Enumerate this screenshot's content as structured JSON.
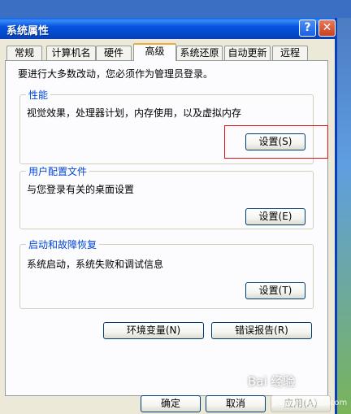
{
  "window": {
    "title": "系统属性"
  },
  "tabs": [
    {
      "label": "常规",
      "active": false
    },
    {
      "label": "计算机名",
      "active": false
    },
    {
      "label": "硬件",
      "active": false
    },
    {
      "label": "高级",
      "active": true
    },
    {
      "label": "系统还原",
      "active": false
    },
    {
      "label": "自动更新",
      "active": false
    },
    {
      "label": "远程",
      "active": false
    }
  ],
  "admin_note": "要进行大多数改动，您必须作为管理员登录。",
  "performance": {
    "title": "性能",
    "description": "视觉效果，处理器计划，内存使用，以及虚拟内存",
    "button": "设置(S)"
  },
  "user_profiles": {
    "title": "用户配置文件",
    "description": "与您登录有关的桌面设置",
    "button": "设置(E)"
  },
  "startup_recovery": {
    "title": "启动和故障恢复",
    "description": "系统启动，系统失败和调试信息",
    "button": "设置(T)"
  },
  "env_vars_button": "环境变量(N)",
  "error_report_button": "错误报告(R)",
  "footer": {
    "ok": "确定",
    "cancel": "取消",
    "apply": "应用(A)"
  },
  "watermark": {
    "text": "Bai 经验",
    "url": "jingyan.baidu.com"
  },
  "colors": {
    "titlebar": "#0554e0",
    "highlight": "#e01010",
    "tab_accent": "#f1a93a"
  }
}
